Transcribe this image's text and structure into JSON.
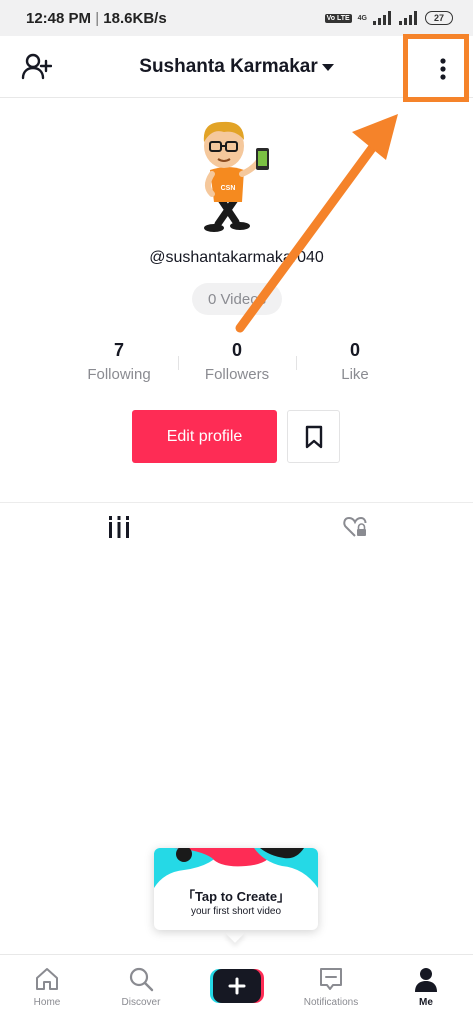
{
  "status_bar": {
    "time": "12:48 PM",
    "speed": "18.6KB/s",
    "network_tag": "4G",
    "sim_tag": "Vo LTE",
    "battery": "27"
  },
  "header": {
    "username": "Sushanta Karmakar"
  },
  "profile": {
    "handle": "@sushantakarmakar040",
    "videos": "0 Videos",
    "stats": [
      {
        "value": "7",
        "label": "Following"
      },
      {
        "value": "0",
        "label": "Followers"
      },
      {
        "value": "0",
        "label": "Like"
      }
    ],
    "edit_label": "Edit profile"
  },
  "create_hint": {
    "title": "「Tap to Create」",
    "subtitle": "your first short video"
  },
  "bottom_nav": {
    "items": [
      {
        "label": "Home",
        "icon": "home-icon"
      },
      {
        "label": "Discover",
        "icon": "search-icon"
      },
      {
        "label": "Notifications",
        "icon": "message-icon"
      },
      {
        "label": "Me",
        "icon": "person-icon"
      }
    ]
  },
  "colors": {
    "accent": "#fe2c55",
    "highlight": "#f5832a"
  }
}
